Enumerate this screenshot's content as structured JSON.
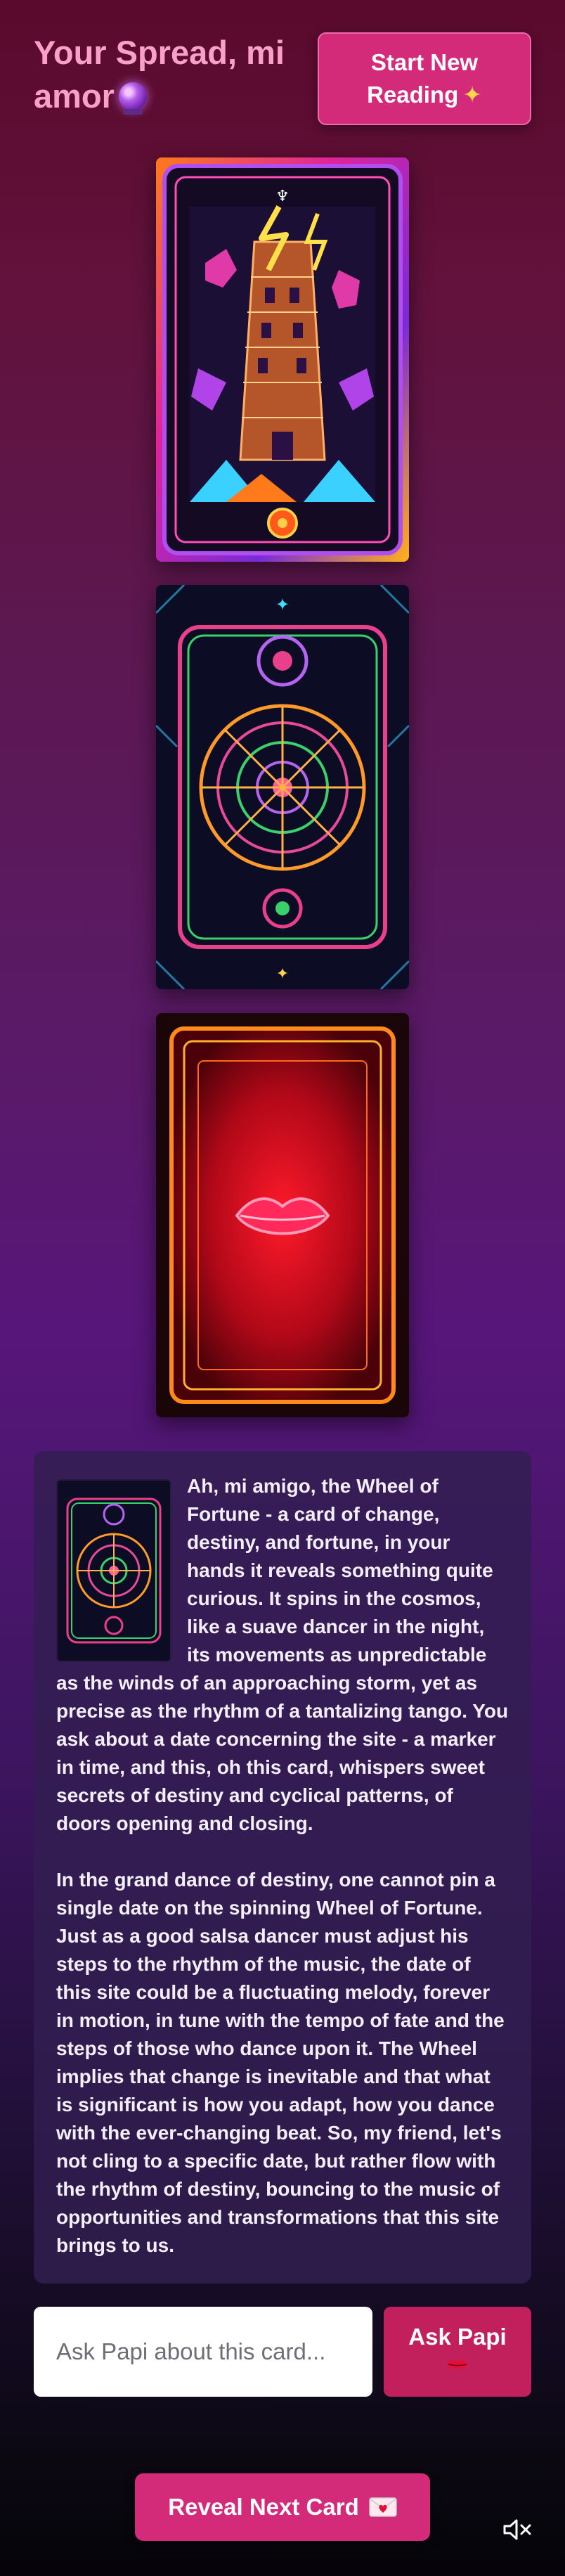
{
  "header": {
    "title": "Your Spread, mi amor",
    "title_icon": "crystal-ball-icon",
    "start_button_line1": "Start New",
    "start_button_line2": "Reading",
    "start_button_icon": "sparkles-icon"
  },
  "cards": [
    {
      "name": "The Tower",
      "state": "revealed"
    },
    {
      "name": "Wheel of Fortune",
      "state": "revealed"
    },
    {
      "name": "card-back",
      "state": "hidden",
      "icon": "lips-icon"
    }
  ],
  "reading": {
    "card": "Wheel of Fortune",
    "paragraph1": "Ah, mi amigo, the Wheel of Fortune - a card of change, destiny, and fortune, in your hands it reveals something quite curious. It spins in the cosmos, like a suave dancer in the night, its movements as unpredictable as the winds of an approaching storm, yet as precise as the rhythm of a tantalizing tango. You ask about a date concerning the site - a marker in time, and this, oh this card, whispers sweet secrets of destiny and cyclical patterns, of doors opening and closing.",
    "paragraph2": "In the grand dance of destiny, one cannot pin a single date on the spinning Wheel of Fortune. Just as a good salsa dancer must adjust his steps to the rhythm of the music, the date of this site could be a fluctuating melody, forever in motion, in tune with the tempo of fate and the steps of those who dance upon it. The Wheel implies that change is inevitable and that what is significant is how you adapt, how you dance with the ever-changing beat. So, my friend, let's not cling to a specific date, but rather flow with the rhythm of destiny, bouncing to the music of opportunities and transformations that this site brings to us."
  },
  "ask": {
    "placeholder": "Ask Papi about this card...",
    "value": "",
    "button_label": "Ask Papi",
    "button_icon": "kiss-mark-icon"
  },
  "footer": {
    "reveal_label": "Reveal Next Card",
    "reveal_icon": "love-letter-icon",
    "mute_icon": "speaker-muted-icon"
  },
  "colors": {
    "accent": "#d42a7a",
    "title": "#f9a0c8",
    "panel": "#321e50"
  }
}
